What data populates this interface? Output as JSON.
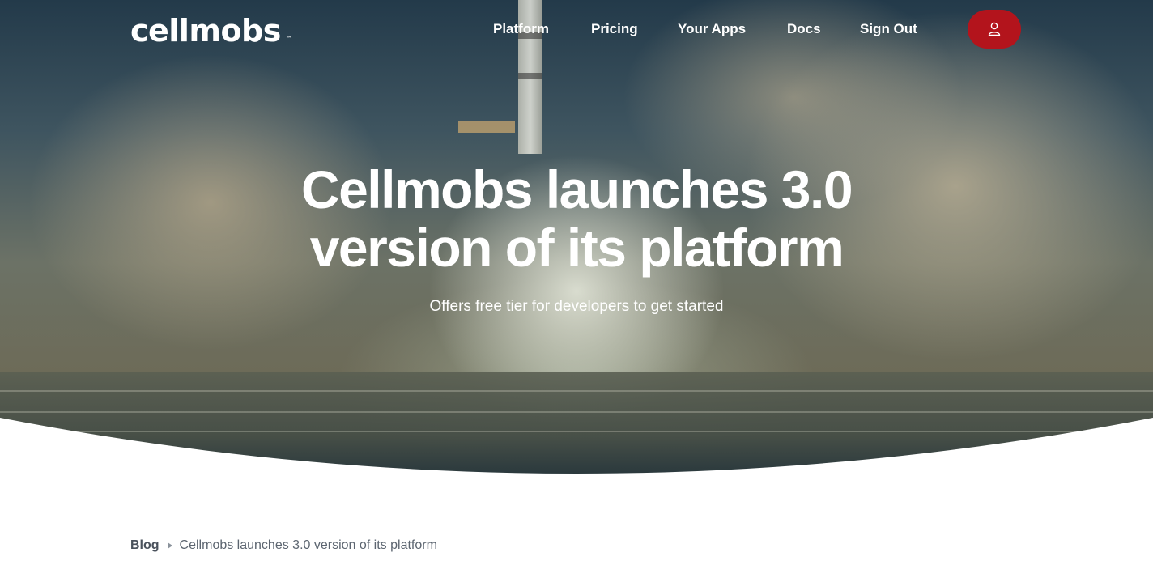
{
  "brand": {
    "logo_text": "cellmobs",
    "trademark": "™"
  },
  "nav": {
    "items": [
      {
        "label": "Platform"
      },
      {
        "label": "Pricing"
      },
      {
        "label": "Your Apps"
      },
      {
        "label": "Docs"
      },
      {
        "label": "Sign Out"
      }
    ],
    "user_button": {
      "icon": "user-icon",
      "color": "#b3141c"
    }
  },
  "hero": {
    "title_line1": "Cellmobs launches 3.0",
    "title_line2": "version of its platform",
    "subtitle": "Offers free tier for developers to get started"
  },
  "breadcrumb": {
    "root": "Blog",
    "separator_icon": "caret-right-icon",
    "current": "Cellmobs launches 3.0 version of its platform"
  }
}
